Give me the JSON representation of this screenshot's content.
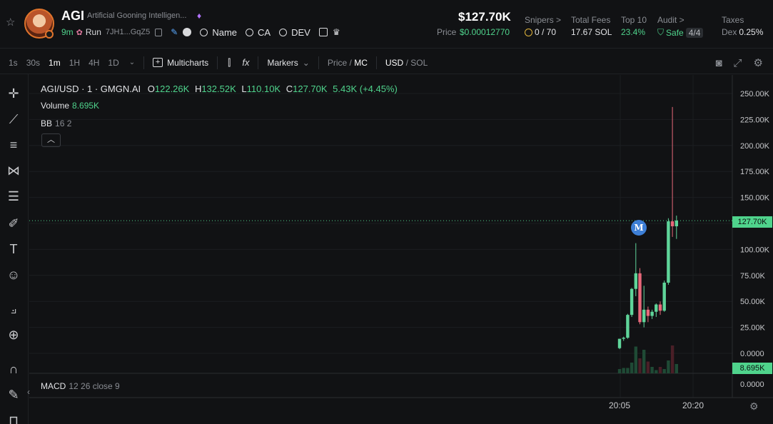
{
  "header": {
    "token_name": "AGI",
    "token_full_name": "Artificial Gooning Intelligen...",
    "age": "9m",
    "run_label": "Run",
    "address": "7JH1...GqZ5",
    "search_name": "Name",
    "search_ca": "CA",
    "search_dev": "DEV",
    "market_cap": "$127.70K",
    "price_label": "Price",
    "price_value": "$0.00012770",
    "stats": {
      "snipers_label": "Snipers >",
      "snipers_value": "0 / 70",
      "total_fees_label": "Total Fees",
      "total_fees_value": "17.67 SOL",
      "top10_label": "Top 10",
      "top10_value": "23.4%",
      "audit_label": "Audit >",
      "audit_value": "Safe",
      "audit_count": "4/4",
      "taxes_label": "Taxes",
      "taxes_dex_label": "Dex",
      "taxes_value": "0.25%"
    }
  },
  "toolbar": {
    "timeframes": [
      "1s",
      "30s",
      "1m",
      "1H",
      "4H",
      "1D"
    ],
    "active_timeframe": "1m",
    "multicharts_label": "Multicharts",
    "markers_label": "Markers",
    "price_label": "Price",
    "mc_label": "MC",
    "usd_label": "USD",
    "sol_label": "SOL"
  },
  "legend": {
    "symbol": "AGI/USD · 1 · GMGN.AI",
    "o_label": "O",
    "o_value": "122.26K",
    "h_label": "H",
    "h_value": "132.52K",
    "l_label": "L",
    "l_value": "110.10K",
    "c_label": "C",
    "c_value": "127.70K",
    "change": "5.43K (+4.45%)",
    "volume_label": "Volume",
    "volume_value": "8.695K",
    "bb_label": "BB",
    "bb_params": "16 2",
    "macd_label": "MACD",
    "macd_params": "12 26 close 9",
    "marker_letter": "M"
  },
  "chart_data": {
    "type": "candlestick",
    "y_ticks": [
      "250.00K",
      "225.00K",
      "200.00K",
      "175.00K",
      "150.00K",
      "125.00K",
      "100.00K",
      "75.00K",
      "50.00K",
      "25.00K",
      "0.0000"
    ],
    "ylim": [
      0,
      250000
    ],
    "x_ticks": [
      "20:05",
      "20:20"
    ],
    "last_price_tag": "127.70K",
    "volume_tag": "8.695K",
    "macd_axis_label": "0.0000",
    "candles": [
      {
        "o": 5000,
        "h": 14000,
        "l": 4000,
        "c": 14000
      },
      {
        "o": 14000,
        "h": 16000,
        "l": 12000,
        "c": 15000
      },
      {
        "o": 15000,
        "h": 38000,
        "l": 14000,
        "c": 37000
      },
      {
        "o": 37000,
        "h": 63000,
        "l": 35000,
        "c": 62000
      },
      {
        "o": 62000,
        "h": 106000,
        "l": 55000,
        "c": 77000
      },
      {
        "o": 77000,
        "h": 82000,
        "l": 28000,
        "c": 30000
      },
      {
        "o": 30000,
        "h": 65000,
        "l": 25000,
        "c": 42000
      },
      {
        "o": 42000,
        "h": 45000,
        "l": 30000,
        "c": 36000
      },
      {
        "o": 36000,
        "h": 42000,
        "l": 33000,
        "c": 40000
      },
      {
        "o": 40000,
        "h": 48000,
        "l": 35000,
        "c": 47000
      },
      {
        "o": 47000,
        "h": 50000,
        "l": 37000,
        "c": 41000
      },
      {
        "o": 41000,
        "h": 70000,
        "l": 40000,
        "c": 68000
      },
      {
        "o": 68000,
        "h": 130000,
        "l": 66000,
        "c": 127000
      },
      {
        "o": 127000,
        "h": 237000,
        "l": 112000,
        "c": 122260
      },
      {
        "o": 122260,
        "h": 132520,
        "l": 110100,
        "c": 127700
      }
    ],
    "volumes": [
      4,
      5,
      5,
      10,
      25,
      14,
      22,
      11,
      6,
      3,
      6,
      4,
      12,
      26,
      8.695
    ]
  }
}
